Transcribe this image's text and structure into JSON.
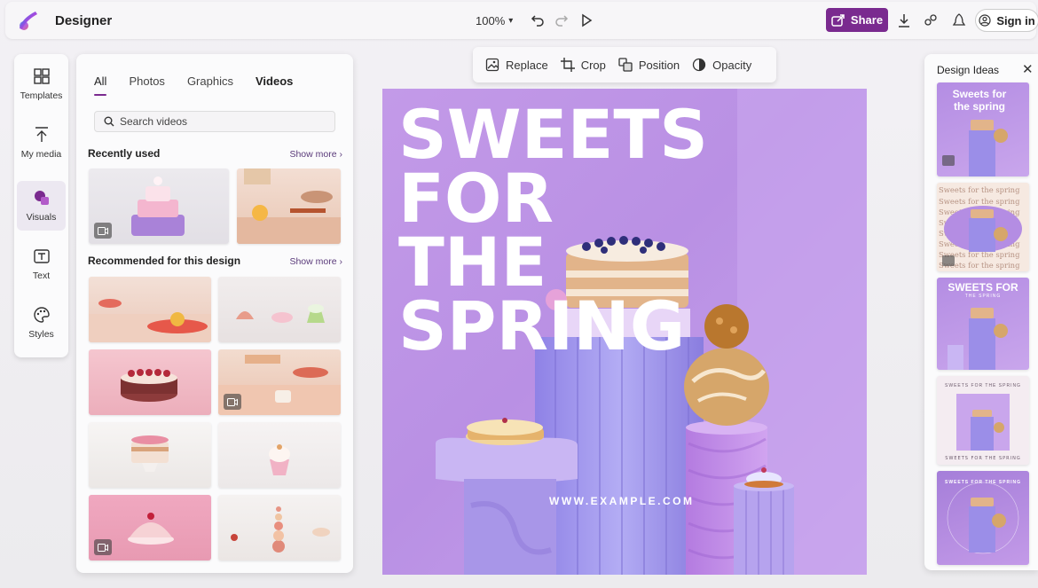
{
  "app": {
    "title": "Designer"
  },
  "toolbar": {
    "zoom": "100%",
    "share_label": "Share",
    "signin_label": "Sign in"
  },
  "rail": {
    "items": [
      {
        "label": "Templates",
        "icon": "templates-icon"
      },
      {
        "label": "My media",
        "icon": "upload-icon"
      },
      {
        "label": "Visuals",
        "icon": "visuals-icon"
      },
      {
        "label": "Text",
        "icon": "text-icon"
      },
      {
        "label": "Styles",
        "icon": "palette-icon"
      }
    ]
  },
  "media_panel": {
    "tabs": [
      "All",
      "Photos",
      "Graphics",
      "Videos"
    ],
    "search_placeholder": "Search videos",
    "recently_used": {
      "title": "Recently used",
      "show_more": "Show more"
    },
    "recommended": {
      "title": "Recommended for this design",
      "show_more": "Show more"
    }
  },
  "context_toolbar": {
    "replace": "Replace",
    "crop": "Crop",
    "position": "Position",
    "opacity": "Opacity"
  },
  "canvas": {
    "headline_lines": [
      "SWEETS",
      "FOR",
      "THE",
      "SPRING"
    ],
    "url": "WWW.EXAMPLE.COM"
  },
  "design_ideas": {
    "title": "Design Ideas",
    "ideas": [
      {
        "text": "Sweets for the spring"
      },
      {
        "text": "Sweets for the spring"
      },
      {
        "text": "SWEETS FOR",
        "sub": "THE SPRING"
      },
      {
        "text": "SWEETS FOR THE SPRING"
      },
      {
        "text": "SWEETS FOR THE SPRING"
      }
    ]
  },
  "colors": {
    "accent": "#7a2a8f",
    "canvas_bg": "#c39ae8",
    "active_rail": "#ece8f1"
  }
}
